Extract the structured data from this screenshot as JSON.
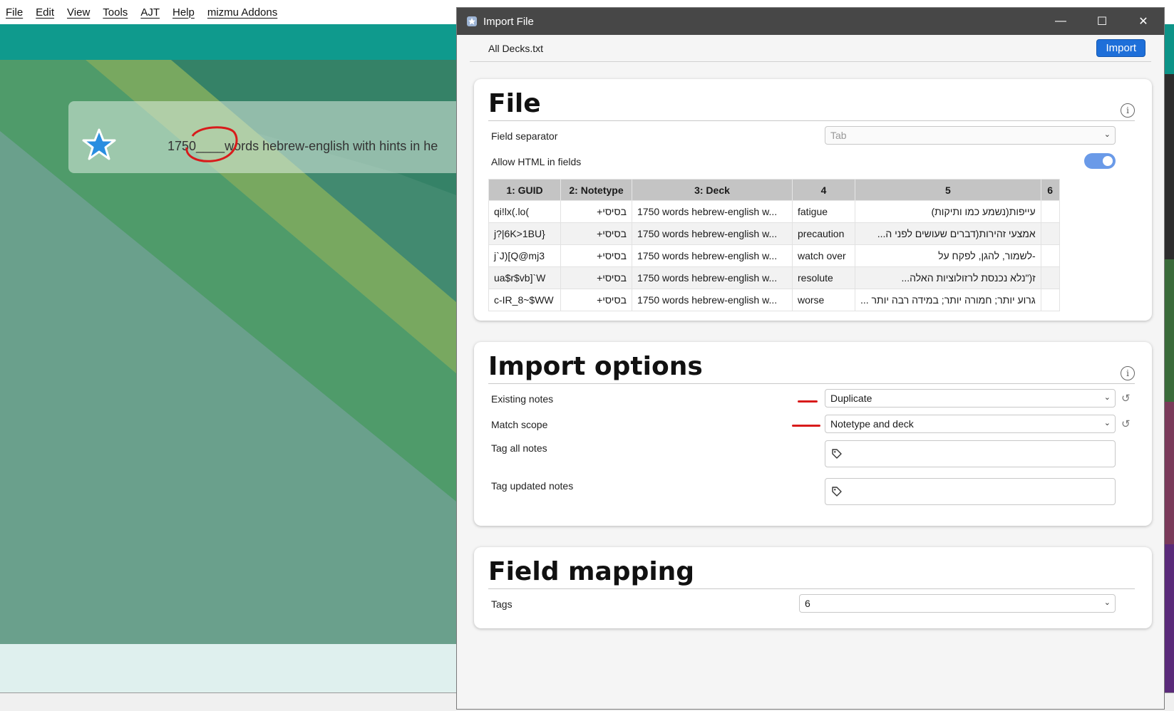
{
  "menubar": {
    "items": [
      "File",
      "Edit",
      "View",
      "Tools",
      "AJT",
      "Help",
      "mizmu Addons"
    ]
  },
  "background": {
    "deck_name": "1750____words hebrew-english with hints in he"
  },
  "dialog": {
    "title": "Import File",
    "file_name": "All Decks.txt",
    "import_label": "Import",
    "file_section": {
      "title": "File",
      "field_separator_label": "Field separator",
      "field_separator_value": "Tab",
      "allow_html_label": "Allow HTML in fields",
      "allow_html_on": true,
      "table": {
        "headers": [
          "1: GUID",
          "2: Notetype",
          "3: Deck",
          "4",
          "5",
          "6"
        ],
        "rows": [
          [
            "qi!lx(.lo(",
            "בסיסי+",
            "1750 words hebrew-english w...",
            "fatigue",
            "עייפות(נשמע כמו ותיקות)",
            ""
          ],
          [
            "j?|6K>1BU}",
            "בסיסי+",
            "1750 words hebrew-english w...",
            "precaution",
            "אמצעי זהירות(דברים שעושים לפני ה...",
            ""
          ],
          [
            "j`J)[Q@mj3",
            "בסיסי+",
            "1750 words hebrew-english w...",
            "watch over",
            "-לשמור, להגן, לפקח על",
            ""
          ],
          [
            "ua$r$vb]`W",
            "בסיסי+",
            "1750 words hebrew-english w...",
            "resolute",
            "ז(\"נלא נכנסת לרזולוציות האלה...",
            ""
          ],
          [
            "c-IR_8~$WW",
            "בסיסי+",
            "1750 words hebrew-english w...",
            "worse",
            "גרוע יותר; חמורה יותר; במידה רבה יותר ...",
            ""
          ]
        ]
      }
    },
    "import_options": {
      "title": "Import options",
      "existing_notes_label": "Existing notes",
      "existing_notes_value": "Duplicate",
      "match_scope_label": "Match scope",
      "match_scope_value": "Notetype and deck",
      "tag_all_label": "Tag all notes",
      "tag_updated_label": "Tag updated notes"
    },
    "field_mapping": {
      "title": "Field mapping",
      "tags_label": "Tags",
      "tags_value": "6"
    }
  },
  "colors": {
    "accent": "#1e6fd9",
    "topbar": "#0f9a8d",
    "annotation": "#d81b1b"
  },
  "icons": [
    "anki-star-icon",
    "info-icon",
    "tag-icon",
    "chevron-down-icon",
    "revert-icon",
    "minimize-icon",
    "maximize-icon",
    "close-icon"
  ]
}
